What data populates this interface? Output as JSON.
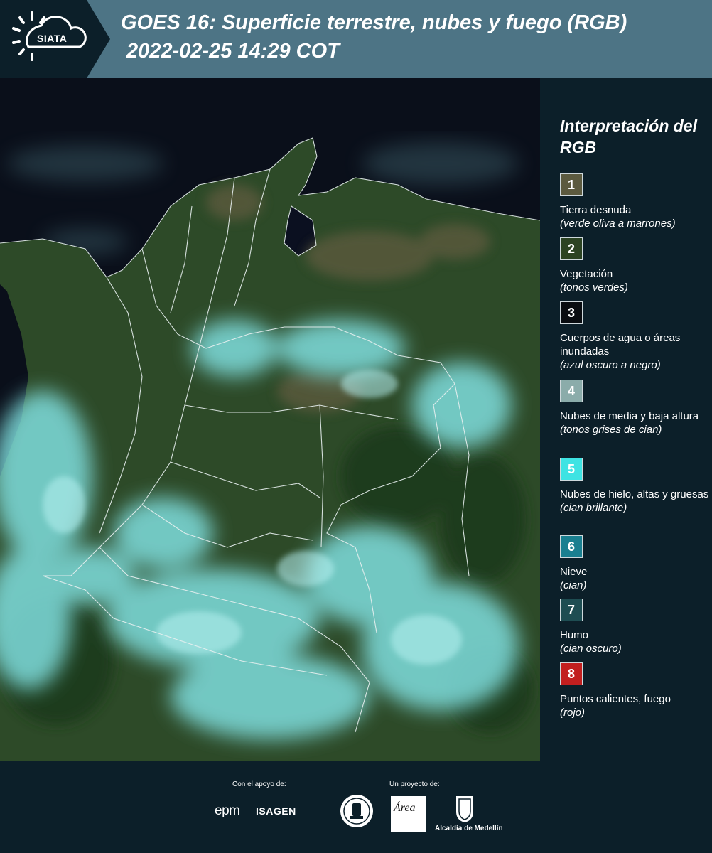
{
  "header": {
    "logo_text": "SIATA",
    "title_line1": "GOES 16: Superficie terrestre, nubes y fuego (RGB)",
    "title_line2": "2022-02-25 14:29 COT"
  },
  "legend": {
    "title": "Interpretación del RGB",
    "items": [
      {
        "number": "1",
        "label": "Tierra desnuda",
        "note": "(verde oliva a marrones)",
        "color": "#5c5a3f"
      },
      {
        "number": "2",
        "label": "Vegetación",
        "note": "(tonos verdes)",
        "color": "#2c4322"
      },
      {
        "number": "3",
        "label": "Cuerpos de agua o áreas inundadas",
        "note": "(azul oscuro a negro)",
        "color": "#090c10"
      },
      {
        "number": "4",
        "label": "Nubes de media y baja altura",
        "note": "(tonos grises de cian)",
        "color": "#8bacaa"
      },
      {
        "number": "5",
        "label": "Nubes de hielo, altas y gruesas",
        "note": "(cian brillante)",
        "color": "#3ee3e3"
      },
      {
        "number": "6",
        "label": "Nieve",
        "note": "(cian)",
        "color": "#1a7f90"
      },
      {
        "number": "7",
        "label": "Humo",
        "note": "(cian oscuro)",
        "color": "#1e4d52"
      },
      {
        "number": "8",
        "label": "Puntos calientes, fuego",
        "note": "(rojo)",
        "color": "#c21f1f"
      }
    ]
  },
  "footer": {
    "support_label": "Con el apoyo de:",
    "project_label": "Un proyecto de:",
    "logos": {
      "epm": "epm",
      "isagen": "ISAGEN",
      "area": "Área",
      "alcaldia": "Alcaldía de Medellín"
    }
  },
  "colors": {
    "header_bg": "#4d7485",
    "page_bg": "#0c1f29",
    "ocean": "#0a0f1a",
    "vegetation": "#2c4322",
    "cloud": "#7fdede"
  }
}
